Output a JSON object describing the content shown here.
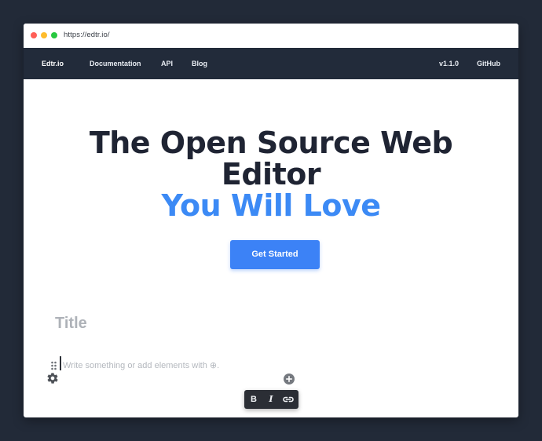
{
  "browser": {
    "url": "https://edtr.io/"
  },
  "navbar": {
    "brand": "Edtr.io",
    "links": [
      "Documentation",
      "API",
      "Blog"
    ],
    "version": "v1.1.0",
    "github": "GitHub"
  },
  "hero": {
    "title_line1": "The Open Source Web",
    "title_line2": "Editor",
    "title_accent": "You Will Love",
    "cta": "Get Started"
  },
  "editor": {
    "title_placeholder": "Title",
    "body_placeholder": "Write something or add elements with ⊕.",
    "toolbar": {
      "bold": "B",
      "italic": "I"
    }
  },
  "icons": {
    "settings": "gear-icon",
    "add": "plus-circle-icon",
    "drag": "drag-handle-icon",
    "link": "link-icon"
  },
  "colors": {
    "page_background": "#222a38",
    "navbar": "#222b3a",
    "accent": "#3c8af5",
    "button": "#3c82f6",
    "heading": "#1f2433",
    "toolbar": "#2b2e35"
  }
}
